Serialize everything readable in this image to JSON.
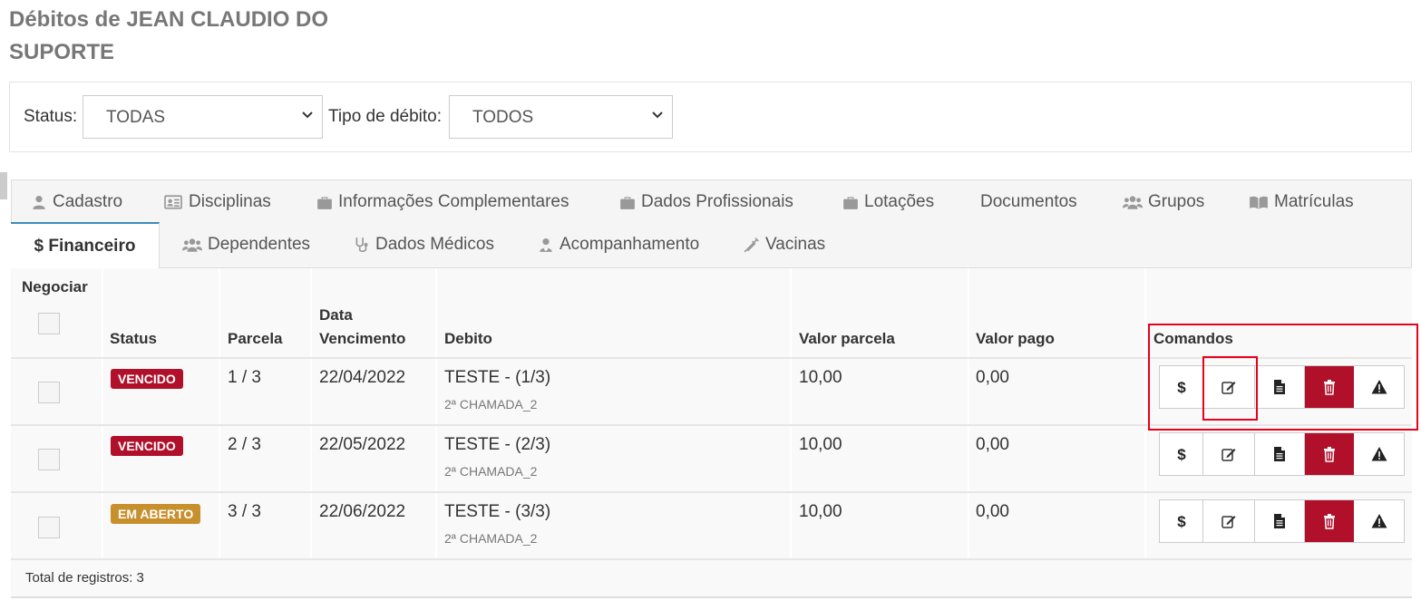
{
  "page_title": "Débitos de JEAN CLAUDIO DO SUPORTE",
  "filters": {
    "status_label": "Status:",
    "status_value": "TODAS",
    "type_label": "Tipo de débito:",
    "type_value": "TODOS"
  },
  "tabs_row1": [
    {
      "label": "Cadastro",
      "icon": "user-icon"
    },
    {
      "label": "Disciplinas",
      "icon": "id-card-icon"
    },
    {
      "label": "Informações Complementares",
      "icon": "briefcase-icon"
    },
    {
      "label": "Dados Profissionais",
      "icon": "briefcase-icon"
    },
    {
      "label": "Lotações",
      "icon": "briefcase-icon"
    },
    {
      "label": "Documentos",
      "icon": ""
    },
    {
      "label": "Grupos",
      "icon": "users-icon"
    },
    {
      "label": "Matrículas",
      "icon": "book-icon"
    }
  ],
  "tabs_row2": [
    {
      "label": "$ Financeiro",
      "icon": "",
      "active": true
    },
    {
      "label": "Dependentes",
      "icon": "users-icon"
    },
    {
      "label": "Dados Médicos",
      "icon": "stethoscope-icon"
    },
    {
      "label": "Acompanhamento",
      "icon": "user-md-icon"
    },
    {
      "label": "Vacinas",
      "icon": "syringe-icon"
    }
  ],
  "table": {
    "headers": {
      "negociar": "Negociar",
      "status": "Status",
      "parcela": "Parcela",
      "data_line1": "Data",
      "data_line2": "Vencimento",
      "debito": "Debito",
      "valor_parcela": "Valor parcela",
      "valor_pago": "Valor pago",
      "comandos": "Comandos"
    },
    "rows": [
      {
        "status": "VENCIDO",
        "status_color": "#b1102b",
        "parcela": "1 / 3",
        "vencimento": "22/04/2022",
        "debito": "TESTE - (1/3)",
        "debito_sub": "2ª CHAMADA_2",
        "valor_parcela": "10,00",
        "valor_pago": "0,00"
      },
      {
        "status": "VENCIDO",
        "status_color": "#b1102b",
        "parcela": "2 / 3",
        "vencimento": "22/05/2022",
        "debito": "TESTE - (2/3)",
        "debito_sub": "2ª CHAMADA_2",
        "valor_parcela": "10,00",
        "valor_pago": "0,00"
      },
      {
        "status": "EM ABERTO",
        "status_color": "#c8902c",
        "parcela": "3 / 3",
        "vencimento": "22/06/2022",
        "debito": "TESTE - (3/3)",
        "debito_sub": "2ª CHAMADA_2",
        "valor_parcela": "10,00",
        "valor_pago": "0,00"
      }
    ],
    "commands": [
      {
        "icon": "dollar-icon",
        "glyph": "$"
      },
      {
        "icon": "edit-icon"
      },
      {
        "icon": "file-icon"
      },
      {
        "icon": "trash-icon"
      },
      {
        "icon": "warning-icon"
      }
    ],
    "footer": "Total de registros: 3"
  },
  "colors": {
    "danger": "#b1102b",
    "warning": "#c8902c",
    "tab_accent": "#3c8dbc",
    "highlight": "#e8001c"
  }
}
